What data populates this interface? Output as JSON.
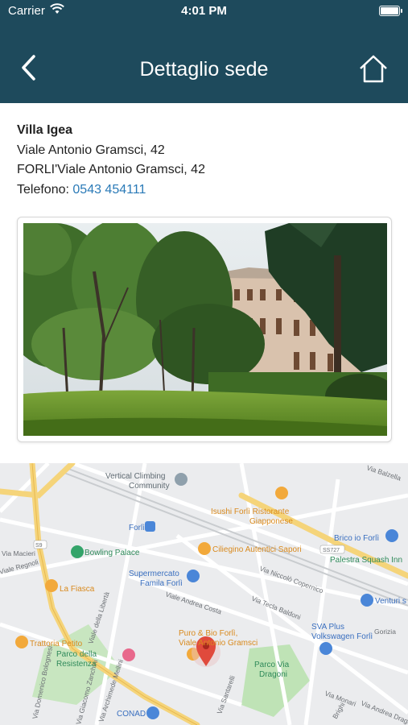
{
  "status_bar": {
    "carrier": "Carrier",
    "time": "4:01 PM"
  },
  "nav": {
    "title": "Dettaglio sede"
  },
  "location": {
    "name": "Villa Igea",
    "address": "Viale Antonio Gramsci, 42",
    "city_address": "FORLI'Viale Antonio Gramsci, 42",
    "phone_label": "Telefono: ",
    "phone": "0543 454111"
  },
  "map": {
    "labels": {
      "vertical_climbing": "Vertical Climbing",
      "community": "Community",
      "isushi_1": "Isushi Forlì Ristorante",
      "isushi_2": "Giapponese",
      "forli": "Forlì",
      "brico": "Brico io Forlì",
      "bowling": "Bowling Palace",
      "ciliegino": "Ciliegino Autentici Sapori",
      "palestra": "Palestra Squash Inn",
      "supermercato_1": "Supermercato",
      "supermercato_2": "Famila Forlì",
      "la_fiasca": "La Fiasca",
      "venturi": "Venturi s",
      "trattoria": "Trattoria Petito",
      "parco_resistenza_1": "Parco della",
      "parco_resistenza_2": "Resistenza",
      "puro_1": "Puro & Bio Forlì,",
      "puro_2": "Viale Antonio Gramsci",
      "sva_1": "SVA Plus",
      "sva_2": "Volkswagen Forlì",
      "parco_dragoni_1": "Parco Via",
      "parco_dragoni_2": "Dragoni",
      "conad": "CONAD",
      "s727": "SS727",
      "s9": "S9",
      "via_andrea_costa": "Viale Andrea Costa",
      "via_niccolo": "Via Niccolò Copernico",
      "via_tecla": "Via Tecla Baldoni",
      "via_liberta": "Viale della Libertà",
      "via_zanchini": "Via Giacomo Zanchini",
      "via_bolognesi": "Via Domenico Bolognesi",
      "via_archimede": "Via Archimede Mellini",
      "via_santarelli": "Via Santarelli",
      "via_monari": "Via Monari",
      "via_balzella": "Via Balzella",
      "via_dragoni": "Via Andrea Dragoni",
      "via_regnoli": "Viale Regnoli",
      "via_macieri": "Via Macieri",
      "via_gorizia": "Gorizia",
      "via_brighi": "Brighi"
    }
  }
}
